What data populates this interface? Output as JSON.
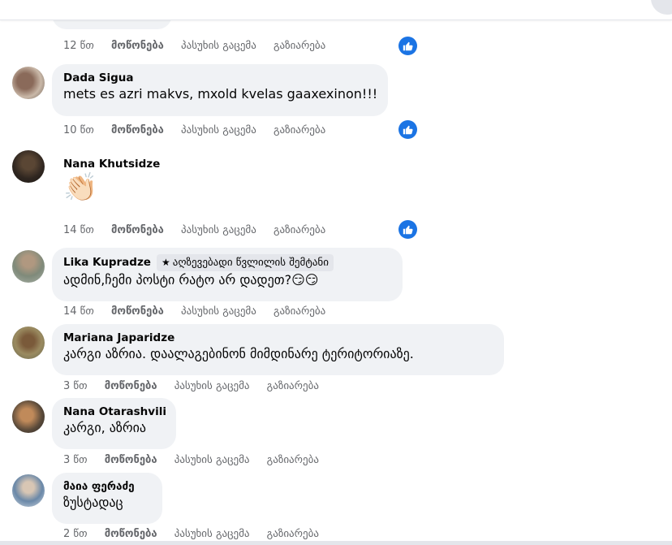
{
  "header": {
    "title": ""
  },
  "truncated_comment": {
    "time": "12 წთ",
    "actions": [
      "მოწონება",
      "პასუხის გაცემა",
      "გაზიარება"
    ]
  },
  "comments": [
    {
      "author": "Dada Sigua",
      "text": "mets es azri makvs, mxold kvelas gaaxexinon!!!",
      "time": "10 წთ",
      "like": "მოწონება",
      "reply": "პასუხის გაცემა",
      "share": "გაზიარება",
      "has_reaction": true
    },
    {
      "author": "Nana Khutsidze",
      "text": "👏🏻",
      "time": "14 წთ",
      "like": "მოწონება",
      "reply": "პასუხის გაცემა",
      "share": "გაზიარება",
      "has_reaction": true
    },
    {
      "author": "Lika Kupradze",
      "badge": "აღზევებადი წვლილის შემტანი",
      "text": "ადმინ,ჩემი პოსტი რატო არ დადეთ?😏😏",
      "time": "14 წთ",
      "like": "მოწონება",
      "reply": "პასუხის გაცემა",
      "share": "გაზიარება",
      "has_reaction": false
    },
    {
      "author": "Mariana Japaridze",
      "text": "კარგი აზრია. დაალაგებინონ მიმდინარე ტერიტორიაზე.",
      "time": "3 წთ",
      "like": "მოწონება",
      "reply": "პასუხის გაცემა",
      "share": "გაზიარება",
      "has_reaction": false
    },
    {
      "author": "Nana Otarashvili",
      "text": "კარგი, აზრია",
      "time": "3 წთ",
      "like": "მოწონება",
      "reply": "პასუხის გაცემა",
      "share": "გაზიარება",
      "has_reaction": false
    },
    {
      "author": "მაია ფერაძე",
      "text": "ზუსტადაც",
      "time": "2 წთ",
      "like": "მოწონება",
      "reply": "პასუხის გაცემა",
      "share": "გაზიარება",
      "has_reaction": false
    }
  ],
  "reaction_icon": "thumbs-up-icon",
  "colors": {
    "accent": "#1b74e4",
    "bubble": "#f0f2f5",
    "meta": "#65676b"
  }
}
